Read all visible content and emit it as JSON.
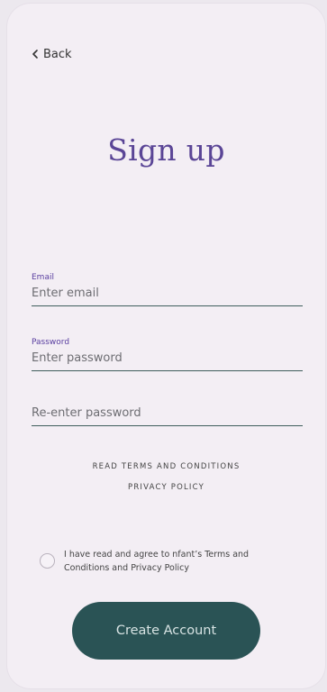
{
  "nav": {
    "back_label": "Back"
  },
  "page": {
    "title": "Sign up"
  },
  "form": {
    "email": {
      "label": "Email",
      "placeholder": "Enter email"
    },
    "password": {
      "label": "Password",
      "placeholder": "Enter password"
    },
    "confirm_password": {
      "placeholder": "Re-enter password"
    }
  },
  "links": {
    "terms": "READ TERMS AND CONDITIONS",
    "privacy": "PRIVACY POLICY"
  },
  "consent": {
    "text": "I have read and agree to nfant’s Terms and Conditions and Privacy Policy"
  },
  "actions": {
    "create_label": "Create Account"
  },
  "colors": {
    "background": "#f3eef4",
    "title": "#5a4596",
    "accent_label": "#5a3fa0",
    "button": "#2a5355",
    "button_text": "#d7e3e3"
  }
}
